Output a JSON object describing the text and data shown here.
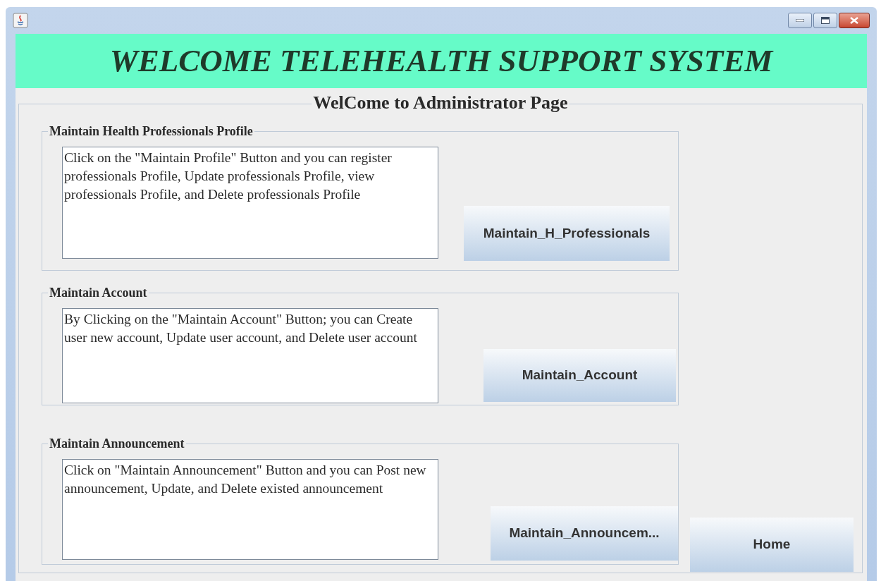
{
  "banner": "WELCOME TELEHEALTH SUPPORT SYSTEM",
  "page_title": "WelCome to Administrator Page",
  "sections": [
    {
      "title": "Maintain Health Professionals Profile",
      "description": "Click on the \"Maintain Profile\" Button and you can register professionals Profile, Update professionals Profile, view professionals Profile, and Delete professionals Profile",
      "button": "Maintain_H_Professionals"
    },
    {
      "title": "Maintain Account",
      "description": "By Clicking on the \"Maintain Account\" Button; you can Create user new account, Update user account, and Delete user account",
      "button": "Maintain_Account"
    },
    {
      "title": "Maintain Announcement",
      "description": "Click on \"Maintain Announcement\" Button and you can Post new announcement, Update, and Delete existed announcement",
      "button": "Maintain_Announcem..."
    }
  ],
  "home_button": "Home"
}
